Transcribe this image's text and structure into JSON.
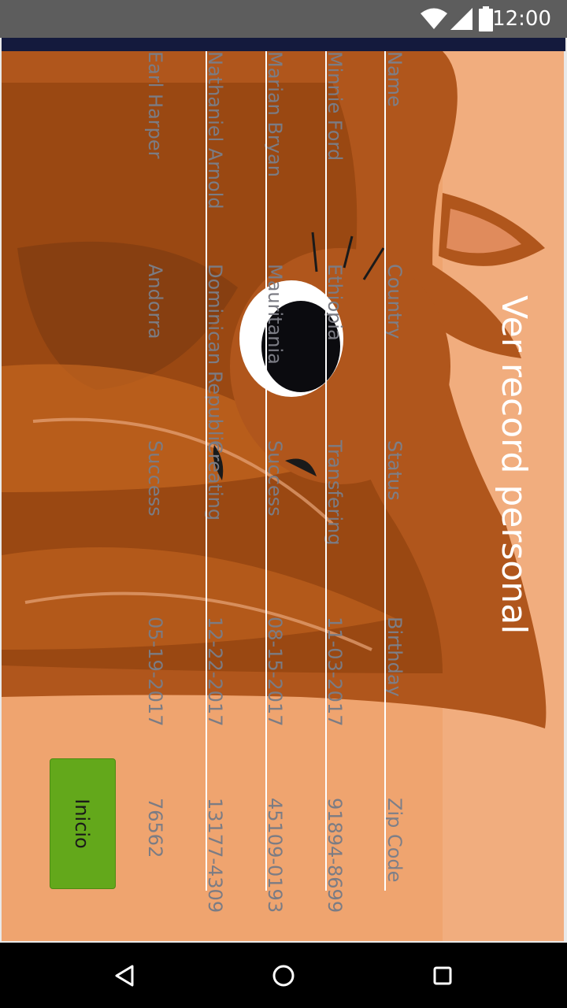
{
  "status_bar": {
    "time": "12:00",
    "icons": [
      "wifi-icon",
      "cellular-signal-icon",
      "battery-icon"
    ]
  },
  "page": {
    "title": "Ver record personal"
  },
  "table": {
    "headers": {
      "name": "Name",
      "country": "Country",
      "status": "Status",
      "birthday": "Birthday",
      "zip": "Zip Code"
    },
    "rows": [
      {
        "name": "Minnie Ford",
        "country": "Ethiopia",
        "status": "Transfering",
        "birthday": "11-03-2017",
        "zip": "91894-8699"
      },
      {
        "name": "Marian Bryan",
        "country": "Mauritania",
        "status": "Success",
        "birthday": "08-15-2017",
        "zip": "45109-0193"
      },
      {
        "name": "Nathaniel Arnold",
        "country": "Dominican Republic",
        "status": "Creating",
        "birthday": "12-22-2017",
        "zip": "13177-4309"
      },
      {
        "name": "Earl Harper",
        "country": "Andorra",
        "status": "Success",
        "birthday": "05-19-2017",
        "zip": "76562"
      }
    ]
  },
  "actions": {
    "home_label": "Inicio"
  },
  "nav_bar": {
    "icons": [
      "back-icon",
      "home-icon",
      "recents-icon"
    ]
  },
  "colors": {
    "background_orange": "#efa46f",
    "button_green": "#63a81b",
    "header_strip": "#141a3d"
  }
}
